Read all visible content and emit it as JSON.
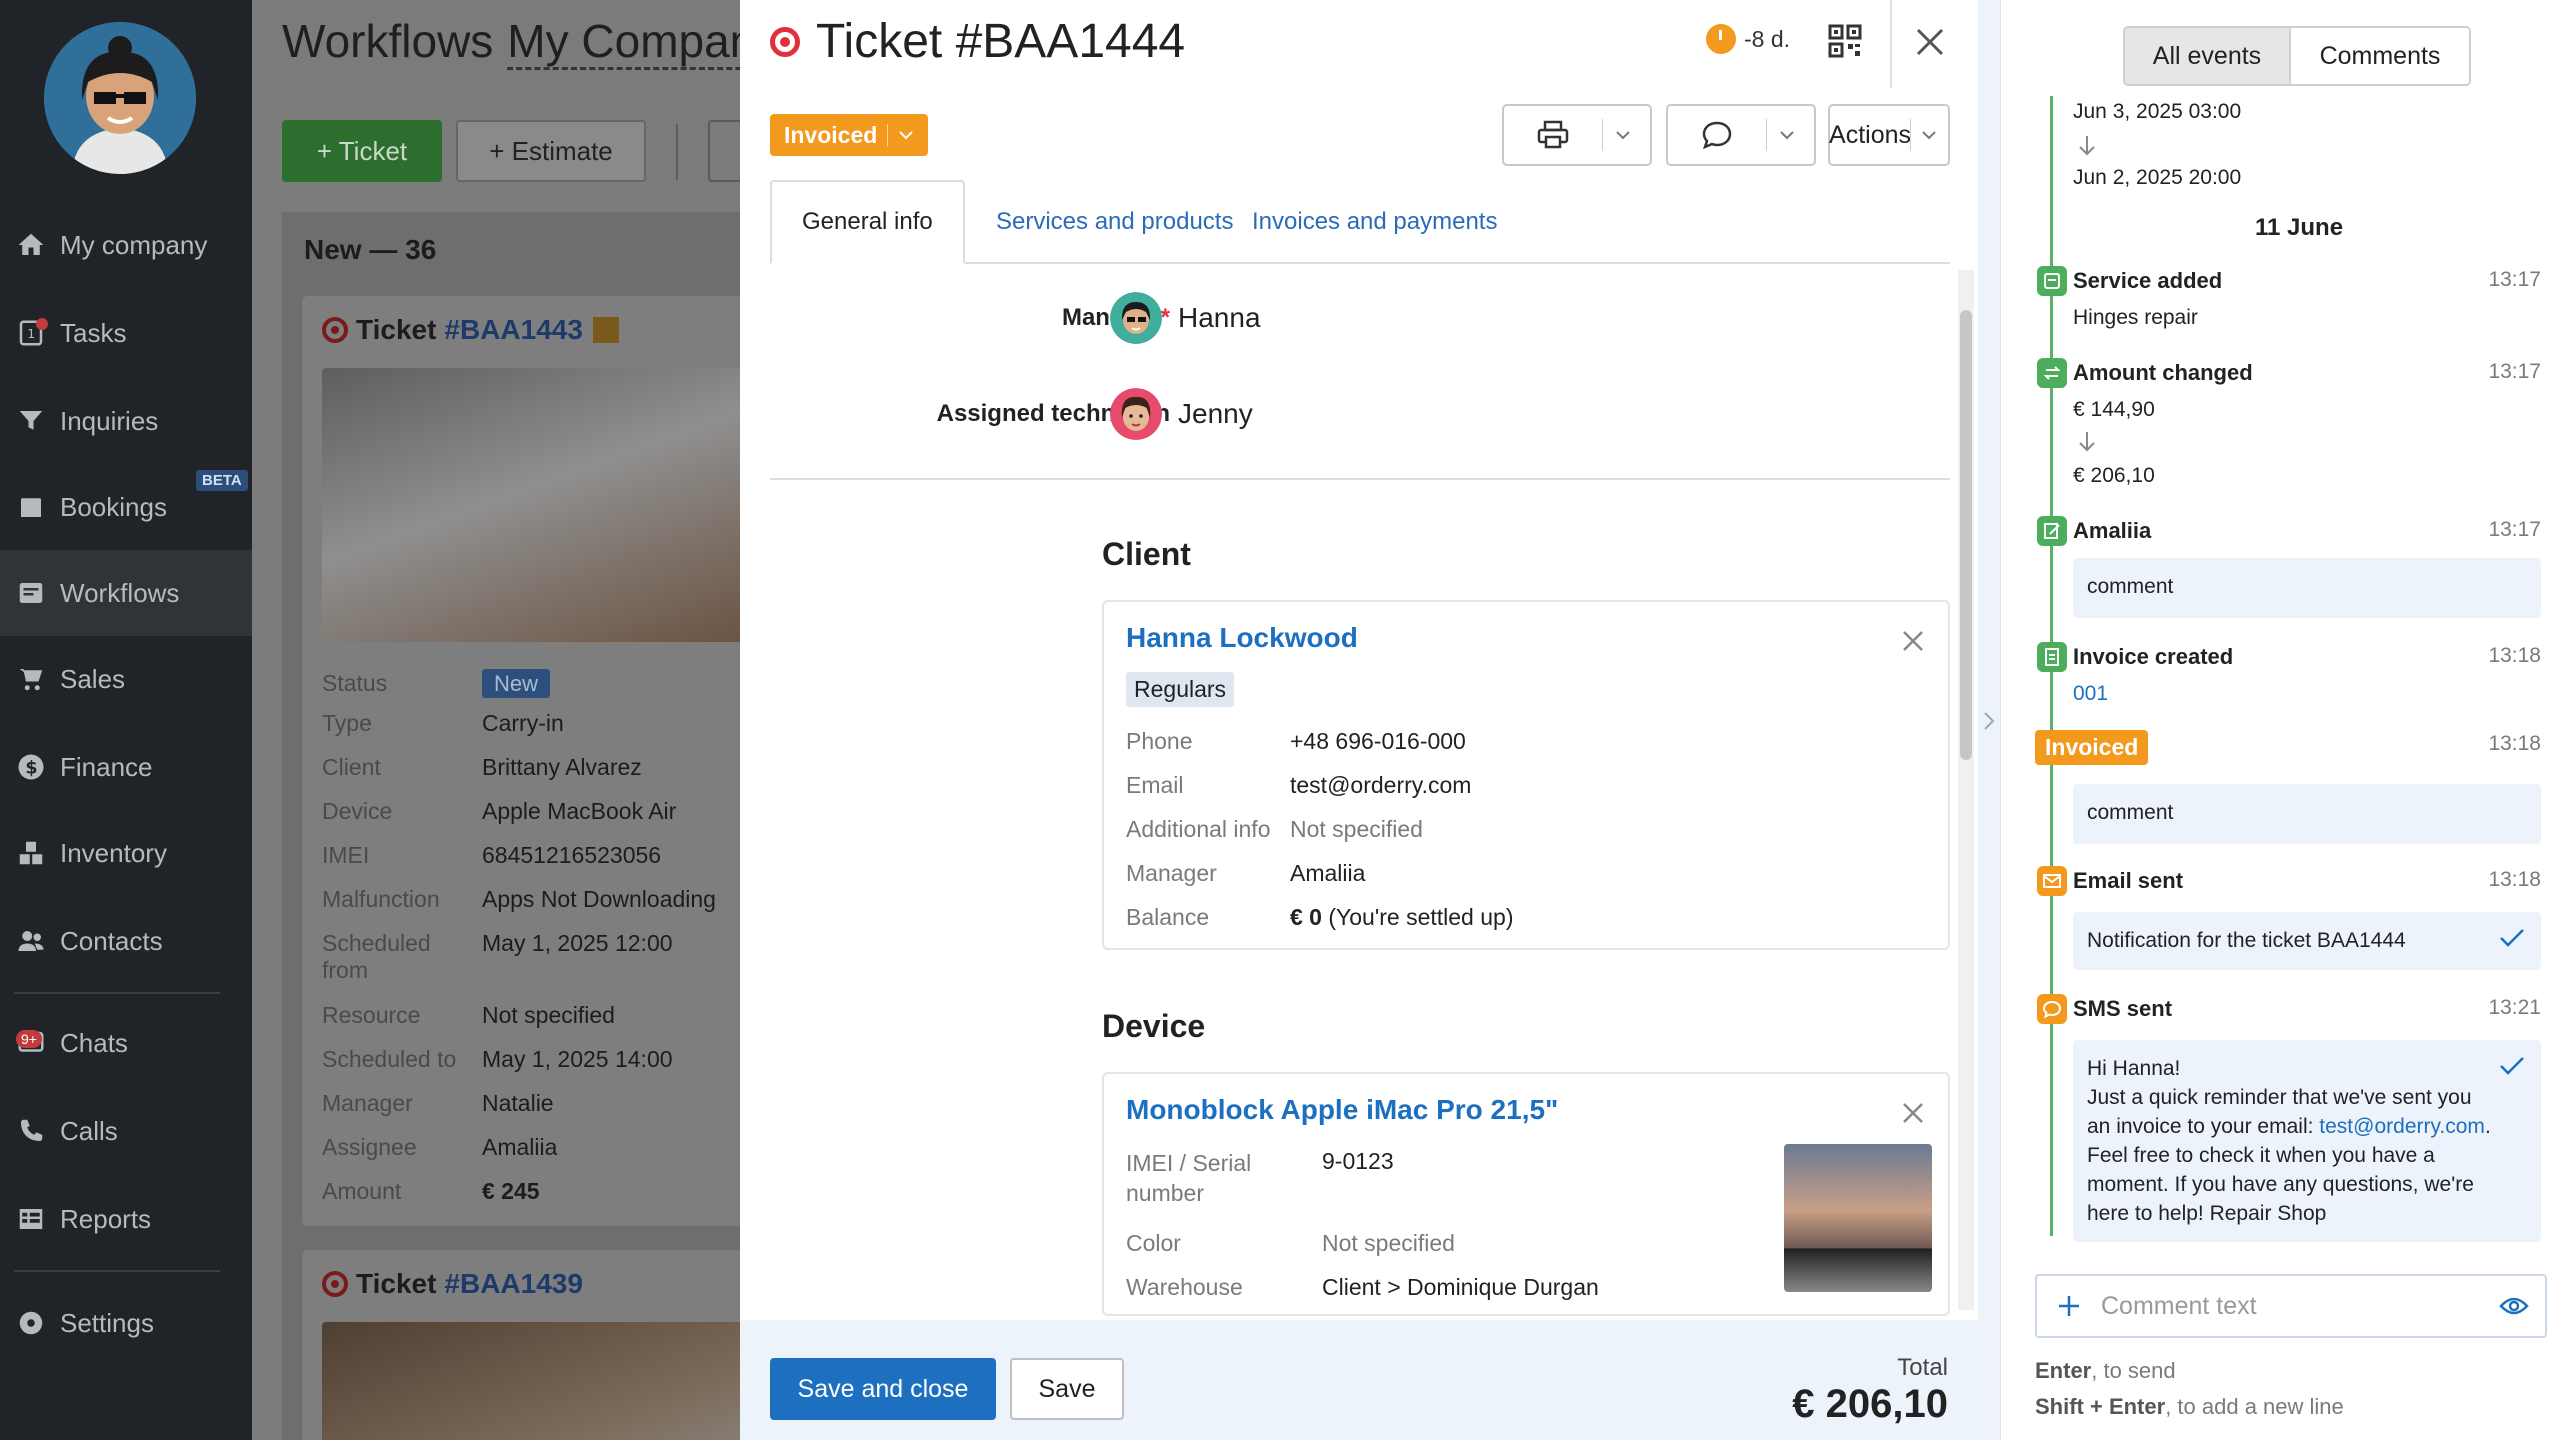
{
  "sidebar": {
    "items": [
      {
        "label": "My company",
        "icon": "home-icon"
      },
      {
        "label": "Tasks",
        "icon": "tasks-icon",
        "badge": "1"
      },
      {
        "label": "Inquiries",
        "icon": "funnel-icon"
      },
      {
        "label": "Bookings",
        "icon": "calendar-icon",
        "badge": "BETA"
      },
      {
        "label": "Workflows",
        "icon": "workflows-icon",
        "active": true
      },
      {
        "label": "Sales",
        "icon": "cart-icon"
      },
      {
        "label": "Finance",
        "icon": "dollar-icon"
      },
      {
        "label": "Inventory",
        "icon": "boxes-icon"
      },
      {
        "label": "Contacts",
        "icon": "contacts-icon"
      },
      {
        "label": "Chats",
        "icon": "chats-icon",
        "badge": "9+"
      },
      {
        "label": "Calls",
        "icon": "phone-icon"
      },
      {
        "label": "Reports",
        "icon": "reports-icon"
      },
      {
        "label": "Settings",
        "icon": "gear-icon"
      }
    ]
  },
  "board": {
    "title": "Workflows",
    "company": "My Company",
    "ticket_btn": "+ Ticket",
    "estimate_btn": "+ Estimate",
    "column_title": "New — 36",
    "card1": {
      "label": "Ticket",
      "id": "#BAA1443",
      "fields": [
        {
          "label": "Status",
          "value": "New"
        },
        {
          "label": "Type",
          "value": "Carry-in"
        },
        {
          "label": "Client",
          "value": "Brittany Alvarez"
        },
        {
          "label": "Device",
          "value": "Apple MacBook Air"
        },
        {
          "label": "IMEI",
          "value": "68451216523056"
        },
        {
          "label": "Malfunction",
          "value": "Apps Not Downloading"
        },
        {
          "label": "Scheduled from",
          "value": "May 1, 2025 12:00"
        },
        {
          "label": "Resource",
          "value": "Not specified"
        },
        {
          "label": "Scheduled to",
          "value": "May 1, 2025 14:00"
        },
        {
          "label": "Manager",
          "value": "Natalie"
        },
        {
          "label": "Assignee",
          "value": "Amaliia"
        },
        {
          "label": "Amount",
          "value": "€ 245"
        }
      ]
    },
    "card2": {
      "label": "Ticket",
      "id": "#BAA1439"
    }
  },
  "modal": {
    "title": "Ticket #BAA1444",
    "deadline": "-8 d.",
    "status": "Invoiced",
    "actions_label": "Actions",
    "tabs": [
      "General info",
      "Services and products",
      "Invoices and payments"
    ],
    "manager_label": "Manager",
    "manager_required": "*",
    "manager_name": "Hanna",
    "technician_label": "Assigned technician",
    "technician_name": "Jenny",
    "client_section": "Client",
    "client": {
      "name": "Hanna Lockwood",
      "tag": "Regulars",
      "rows": [
        {
          "label": "Phone",
          "value": "+48 696-016-000"
        },
        {
          "label": "Email",
          "value": "test@orderry.com"
        },
        {
          "label": "Additional info",
          "value": "Not specified"
        },
        {
          "label": "Manager",
          "value": "Amaliia"
        }
      ],
      "balance_label": "Balance",
      "balance_amount": "€ 0",
      "balance_note": "(You're settled up)"
    },
    "device_section": "Device",
    "device": {
      "name": "Monoblock Apple iMac Pro 21,5\"",
      "rows": [
        {
          "label": "IMEI / Serial number",
          "value": "9-0123"
        },
        {
          "label": "Color",
          "value": "Not specified"
        },
        {
          "label": "Warehouse",
          "value": "Client > Dominique Durgan"
        }
      ]
    },
    "save_close": "Save and close",
    "save": "Save",
    "total_label": "Total",
    "total_value": "€ 206,10"
  },
  "events": {
    "tabs": [
      "All events",
      "Comments"
    ],
    "old_from": "Jun 3, 2025 03:00",
    "old_to": "Jun 2, 2025 20:00",
    "day": "11 June",
    "items": [
      {
        "title": "Service added",
        "time": "13:17",
        "text": "Hinges repair"
      },
      {
        "title": "Amount changed",
        "time": "13:17",
        "from": "€ 144,90",
        "to": "€ 206,10"
      },
      {
        "title": "Amaliia",
        "time": "13:17",
        "comment": "comment"
      },
      {
        "title": "Invoice created",
        "time": "13:18",
        "link": "001"
      },
      {
        "title": "Invoiced",
        "time": "13:18",
        "comment": "comment"
      },
      {
        "title": "Email sent",
        "time": "13:18",
        "comment": "Notification for the ticket BAA1444"
      },
      {
        "title": "SMS sent",
        "time": "13:21"
      }
    ],
    "sms": {
      "line1": "Hi Hanna!",
      "line2": "Just a quick reminder that we've sent you",
      "line3_pre": "an invoice to your email:",
      "line3_link": "test@orderry.com",
      "line3_post": ".",
      "line4": "Feel free to check it when you have a",
      "line5": "moment. If you have any questions, we're",
      "line6": "here to help! Repair Shop"
    },
    "comment_placeholder": "Comment text",
    "hint1_key": "Enter",
    "hint1_text": ", to send",
    "hint2_key": "Shift + Enter",
    "hint2_text": ", to add a new line"
  }
}
